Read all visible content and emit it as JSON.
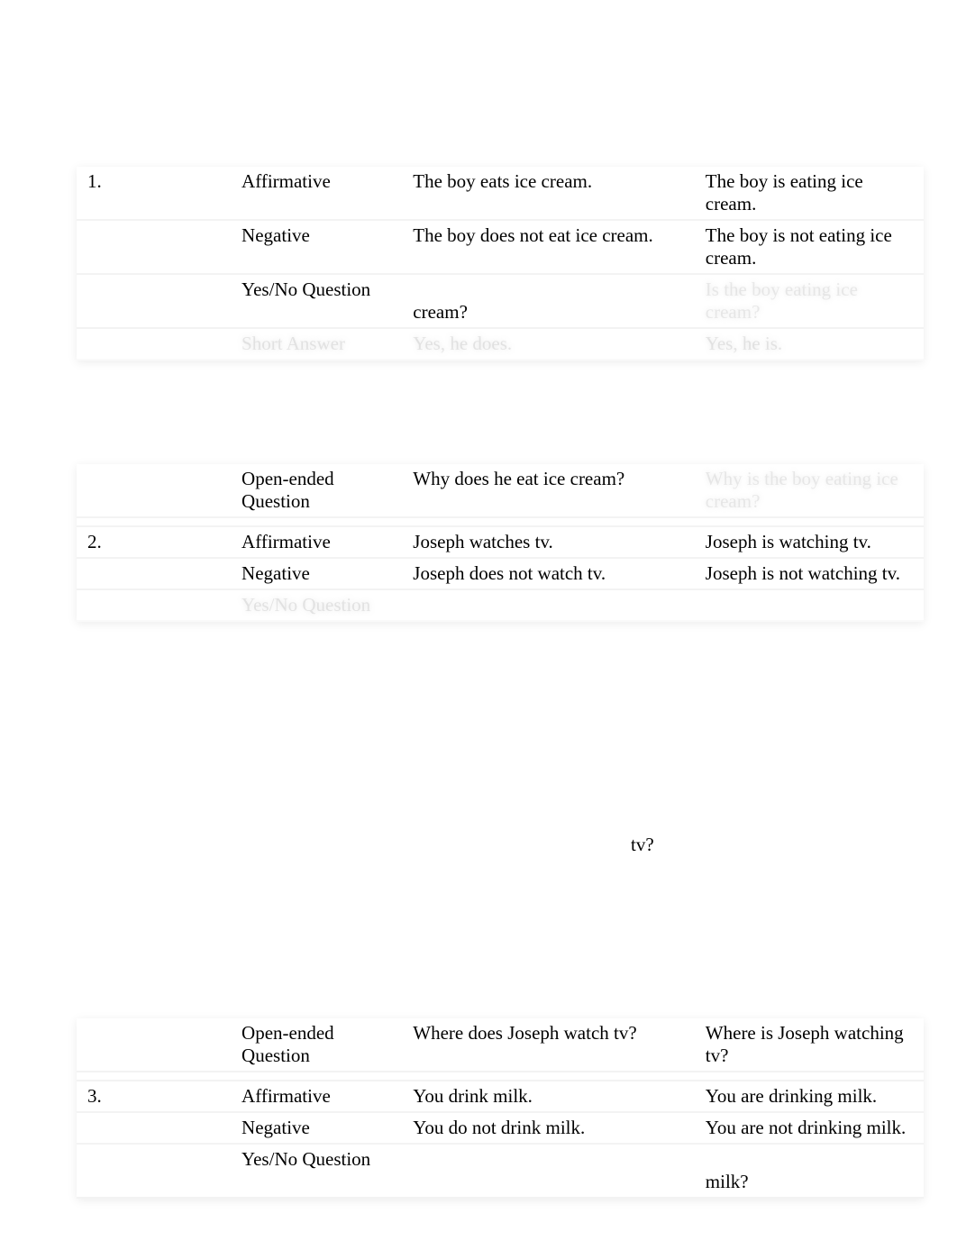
{
  "blocks": [
    {
      "rows": [
        {
          "num": "1.",
          "type": "Affirmative",
          "a": "The boy eats ice cream.",
          "b": "The boy is eating ice cream."
        },
        {
          "num": "",
          "type": "Negative",
          "a": "The boy does not eat ice cream.",
          "b": "The boy is not eating ice cream."
        },
        {
          "num": "",
          "type": "Yes/No Question",
          "a": "cream?",
          "b": "Is the boy eating ice cream?",
          "hiddenB": true,
          "twoLineA": true
        },
        {
          "num": "",
          "type": "Short Answer",
          "a": "Yes, he does.",
          "b": "Yes, he is.",
          "hiddenRow": true
        }
      ]
    },
    {
      "rows": [
        {
          "num": "",
          "type": "Open-ended Question",
          "a": "Why does he eat ice cream?",
          "b": "Why is the boy eating ice cream?",
          "hiddenB": true
        },
        {
          "spacer": true
        },
        {
          "num": "2.",
          "type": "Affirmative",
          "a": "Joseph watches tv.",
          "b": "Joseph is watching tv."
        },
        {
          "num": "",
          "type": "Negative",
          "a": "Joseph does not watch tv.",
          "b": "Joseph is not watching tv."
        },
        {
          "num": "",
          "type": "Yes/No Question",
          "a": "",
          "b": "",
          "hiddenRow": true
        }
      ]
    },
    {
      "float": "tv?"
    },
    {
      "rows": [
        {
          "num": "",
          "type": "Open-ended Question",
          "a": "Where does Joseph watch tv?",
          "b": "Where is Joseph watching tv?"
        },
        {
          "spacer": true
        },
        {
          "num": "3.",
          "type": "Affirmative",
          "a": "You drink milk.",
          "b": "You are drinking milk."
        },
        {
          "num": "",
          "type": "Negative",
          "a": "You do not drink milk.",
          "b": "You are not drinking milk."
        },
        {
          "num": "",
          "type": "Yes/No Question",
          "a": "",
          "b": "milk?",
          "twoLineB": true
        }
      ]
    }
  ]
}
